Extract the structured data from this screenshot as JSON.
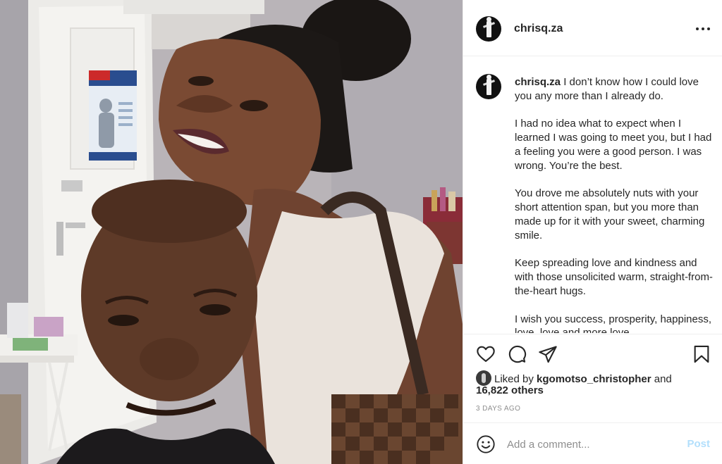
{
  "post": {
    "username": "chrisq.za",
    "photo_alt": "Selfie of a smiling woman leaning on a man's head",
    "caption": {
      "username": "chrisq.za",
      "first_line": "I don’t know how I could love you any more than I already do.",
      "paragraphs": [
        "I had no idea what to expect when I learned I was going to meet you, but I had a feeling you were a good person. I was wrong. You’re the best.",
        "You drove me absolutely nuts with your short attention span, but you more than made up for it with your sweet, charming smile.",
        "Keep spreading love and kindness and with those unsolicited warm, straight-from-the-heart hugs.",
        "I wish you success, prosperity, happiness, love, love and more love."
      ]
    },
    "likes": {
      "prefix": "Liked by",
      "user": "kgomotso_christopher",
      "and": "and",
      "others": "16,822 others"
    },
    "timestamp": "3 days ago",
    "comment": {
      "placeholder": "Add a comment...",
      "post_label": "Post"
    }
  },
  "icons": {
    "more": "more-options-icon",
    "like": "heart-icon",
    "comment": "comment-icon",
    "share": "share-icon",
    "save": "bookmark-icon",
    "emoji": "emoji-icon"
  },
  "colors": {
    "text": "#262626",
    "muted": "#8e8e8e",
    "post_disabled": "#b2dffc",
    "divider": "#efefef"
  }
}
